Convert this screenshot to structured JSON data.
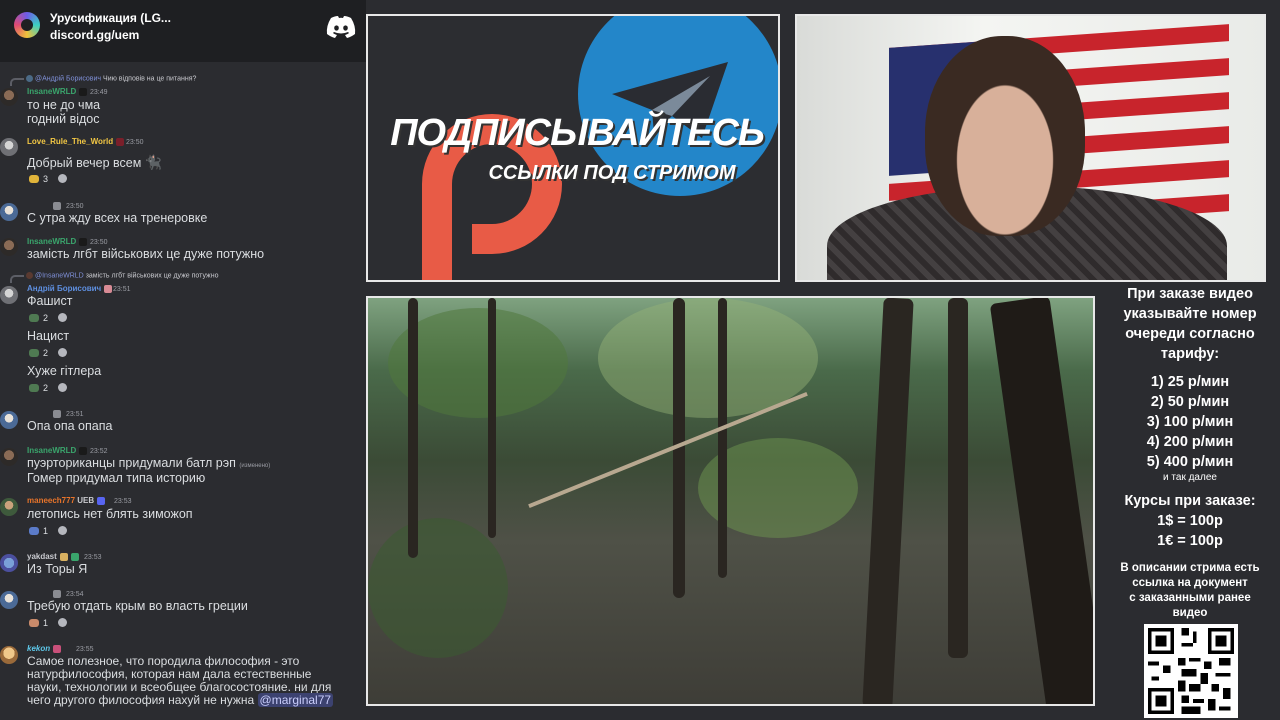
{
  "discord": {
    "server_name": "Урусификация (LG...",
    "invite": "discord.gg/uem",
    "messages": [
      {
        "reply_to": "@Андрій Борисович",
        "reply_text": "Чию відповів на це питання?",
        "author": "InsaneWRLD",
        "time": "23:49",
        "lines": [
          "то не до чма",
          "годний відос"
        ]
      },
      {
        "author": "Love_Rule_The_World",
        "time": "23:50",
        "lines": [
          "Добрый вечер всем"
        ],
        "reaction_count": "3"
      },
      {
        "author": "",
        "time": "23:50",
        "lines": [
          "С утра жду всех на тренеровке"
        ]
      },
      {
        "author": "InsaneWRLD",
        "time": "23:50",
        "lines": [
          "замість лгбт військових це дуже потужно"
        ]
      },
      {
        "reply_to": "@InsaneWRLD",
        "reply_text": "замість лгбт військових це дуже потужно",
        "author": "Андрій Борисович",
        "time": "23:51",
        "lines": [
          "Фашист"
        ],
        "reaction_count": "2"
      },
      {
        "lines": [
          "Нацист"
        ],
        "reaction_count": "2"
      },
      {
        "lines": [
          "Хуже гітлера"
        ],
        "reaction_count": "2"
      },
      {
        "author": "",
        "time": "23:51",
        "lines": [
          "Опа опа опапа"
        ]
      },
      {
        "author": "InsaneWRLD",
        "time": "23:52",
        "lines": [
          "пуэрториканцы придумали батл рэп",
          "Гомер придумал типа историю"
        ],
        "edited": "(изменено)"
      },
      {
        "author": "maneech777",
        "tag": "UEB",
        "time": "23:53",
        "lines": [
          "летопись нет блять зиможоп"
        ],
        "reaction_count": "1"
      },
      {
        "author": "yakdast",
        "time": "23:53",
        "lines": [
          "Из Торы Я"
        ]
      },
      {
        "author": "",
        "time": "23:54",
        "lines": [
          "Требую отдать крым во власть греции"
        ],
        "reaction_count": "1"
      },
      {
        "author": "kekon",
        "time": "23:55",
        "lines": [
          "Самое полезное, что породила философия - это",
          "натурфилософия, которая нам дала естественные",
          "науки, технологии и всеобщее благосостояние. ни для",
          "чего другого философия нахуй не нужна"
        ],
        "mention": "@marginal77"
      }
    ]
  },
  "promo": {
    "title": "ПОДПИСЫВАЙТЕСЬ",
    "subtitle": "ССЫЛКИ ПОД СТРИМОМ"
  },
  "info": {
    "heading": [
      "При заказе видео",
      "указывайте номер",
      "очереди согласно",
      "тарифу:"
    ],
    "tariffs": [
      "1) 25 р/мин",
      "2) 50 р/мин",
      "3) 100 р/мин",
      "4) 200 р/мин",
      "5) 400 р/мин"
    ],
    "tariffs_note": "и так далее",
    "rates_title": "Курсы при заказе:",
    "rates": [
      "1$ = 100р",
      "1€ = 100р"
    ],
    "footer": [
      "В описании стрима есть",
      "ссылка на документ",
      "с заказанными ранее",
      "видео"
    ]
  },
  "colors": {
    "chat_bg": "#2b2c30",
    "header_bg": "#1e1f22",
    "name_green": "#3aa56c",
    "name_yellow": "#f2c744",
    "name_blue": "#5e8fe0",
    "name_orange": "#e8742a",
    "name_gray": "#9a9ca3",
    "telegram": "#2386c9",
    "patreon": "#e85b46"
  }
}
